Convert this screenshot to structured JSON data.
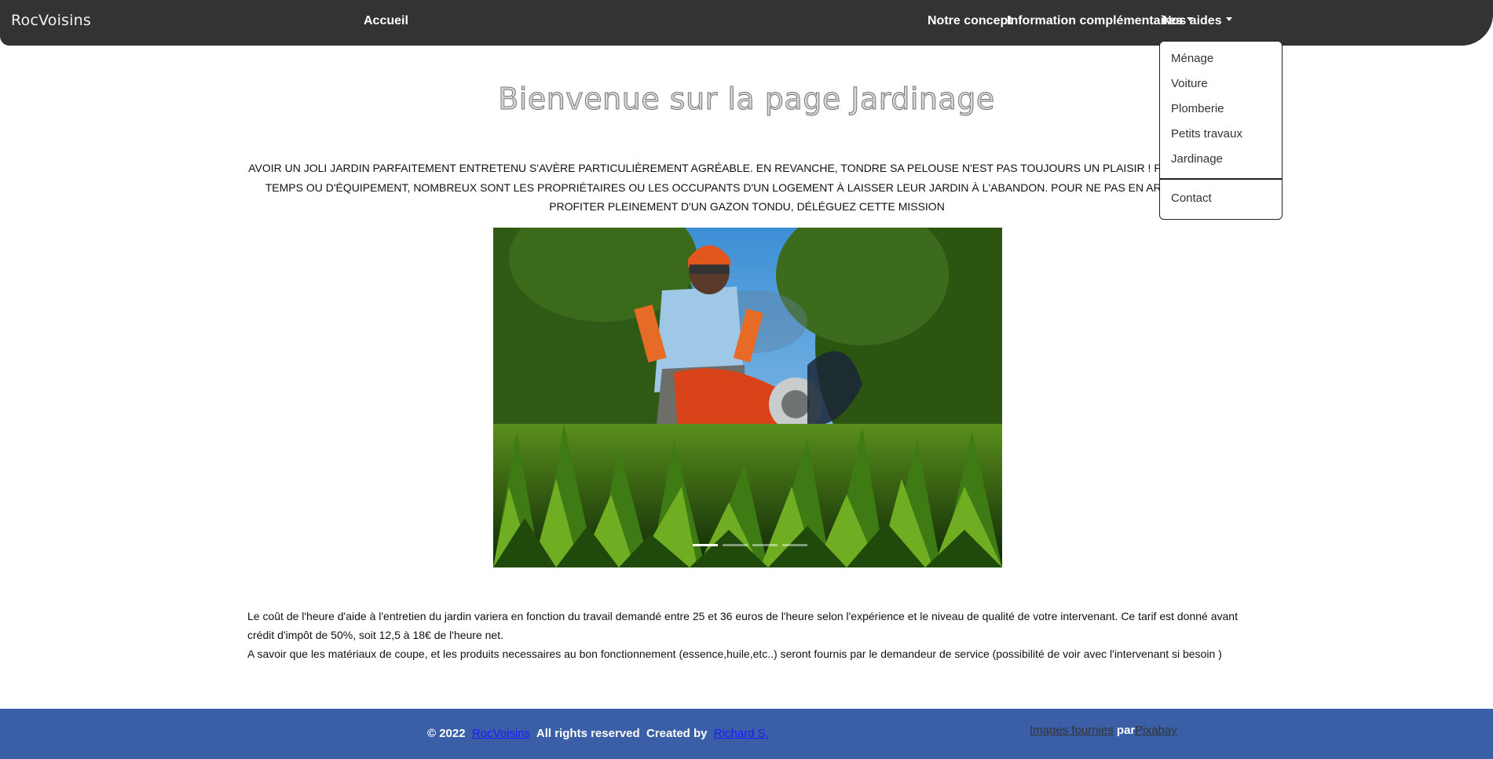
{
  "nav": {
    "brand": "RocVoisins",
    "home": "Accueil",
    "concept": "Notre concept",
    "info": "Information complémentaires",
    "aids": "Nos aides"
  },
  "dropdown": {
    "items": [
      "Ménage",
      "Voiture",
      "Plomberie",
      "Petits travaux",
      "Jardinage"
    ],
    "contact": "Contact"
  },
  "page": {
    "title": "Bienvenue sur la page Jardinage",
    "intro": "Avoir un joli jardin parfaitement entretenu s'avère particulièrement agréable. En revanche, tondre sa pelouse n'est pas toujours un plaisir ! Par manque de temps ou d'équipement, nombreux sont les propriétaires ou les occupants d'un logement à laisser leur jardin à l'abandon. Pour ne pas en arriver là et profiter pleinement d'un gazon tondu, déléguez cette mission",
    "cost_text": "Le coût de l'heure d'aide à l'entretien du jardin variera en fonction du travail demandé entre 25 et 36 euros de l'heure selon l'expérience et le niveau de qualité de votre intervenant. Ce tarif est donné avant crédit d'impôt de 50%, soit 12,5 à 18€ de l'heure net.",
    "materials_text": "A savoir que les matériaux de coupe, et les produits necessaires au bon fonctionnement (essence,huile,etc..) seront fournis par le demandeur de service (possibilité de voir avec l'intervenant si besoin )"
  },
  "carousel": {
    "slide_count": 4,
    "active_index": 0
  },
  "footer": {
    "copyright": "© 2022",
    "site_link": "RocVoisins",
    "rights": "All rights reserved",
    "created_by": "Created by",
    "author": "Richard S.",
    "images_link": "Images fournies",
    "par": "par",
    "pixabay": "Pixabay"
  },
  "colors": {
    "navbar": "#333333",
    "footer": "#3a5fa6",
    "link": "#1a1aff"
  }
}
